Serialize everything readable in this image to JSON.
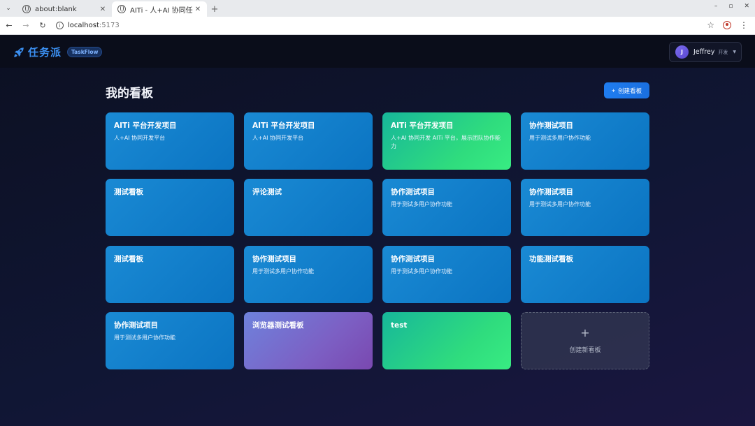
{
  "browser": {
    "tabs": [
      {
        "title": "about:blank",
        "active": false
      },
      {
        "title": "AITi - 人+AI 协同任务管理",
        "active": true
      }
    ],
    "url_host": "localhost",
    "url_port": ":5173"
  },
  "header": {
    "logo_text": "任务派",
    "logo_badge": "TaskFlow",
    "user": {
      "initial": "J",
      "name": "Jeffrey",
      "role": "开发"
    }
  },
  "main": {
    "title": "我的看板",
    "create_button": "创建看板",
    "boards": [
      {
        "title": "AITi 平台开发项目",
        "desc": "人+AI 协同开发平台",
        "theme": "blue"
      },
      {
        "title": "AITi 平台开发项目",
        "desc": "人+AI 协同开发平台",
        "theme": "blue"
      },
      {
        "title": "AITi 平台开发项目",
        "desc": "人+AI 协同开发 AITi 平台，展示团队协作能力",
        "theme": "green"
      },
      {
        "title": "协作测试项目",
        "desc": "用于测试多用户协作功能",
        "theme": "blue"
      },
      {
        "title": "测试看板",
        "desc": "",
        "theme": "blue"
      },
      {
        "title": "评论测试",
        "desc": "",
        "theme": "blue"
      },
      {
        "title": "协作测试项目",
        "desc": "用于测试多用户协作功能",
        "theme": "blue"
      },
      {
        "title": "协作测试项目",
        "desc": "用于测试多用户协作功能",
        "theme": "blue"
      },
      {
        "title": "测试看板",
        "desc": "",
        "theme": "blue"
      },
      {
        "title": "协作测试项目",
        "desc": "用于测试多用户协作功能",
        "theme": "blue"
      },
      {
        "title": "协作测试项目",
        "desc": "用于测试多用户协作功能",
        "theme": "blue"
      },
      {
        "title": "功能测试看板",
        "desc": "",
        "theme": "blue"
      },
      {
        "title": "协作测试项目",
        "desc": "用于测试多用户协作功能",
        "theme": "blue"
      },
      {
        "title": "浏览器测试看板",
        "desc": "",
        "theme": "purple"
      },
      {
        "title": "test",
        "desc": "",
        "theme": "green"
      }
    ],
    "new_board": {
      "icon": "+",
      "label": "创建新看板"
    }
  },
  "icons": {
    "logo": "rocket-icon",
    "tab_favicon": "globe-icon",
    "bookmark": "star-icon",
    "profile": "profile-icon",
    "menu": "kebab-menu-icon"
  },
  "colors": {
    "accent": "#1f7df0",
    "card_blue": "#0b74c2",
    "card_green": "#2fdc7e",
    "card_purple": "#7c60c4",
    "logo": "#3b8ff0"
  }
}
